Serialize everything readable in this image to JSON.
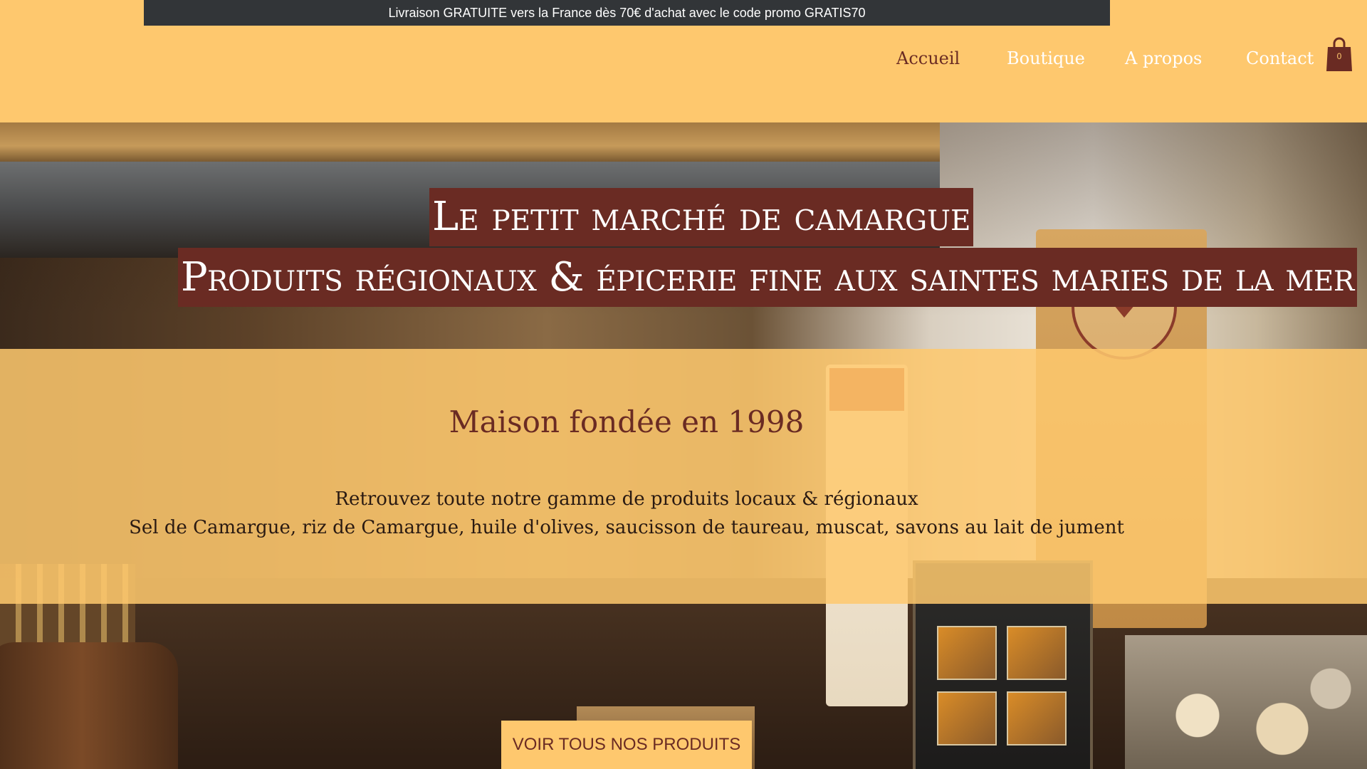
{
  "promo_bar": {
    "text": "Livraison GRATUITE vers la France dès 70€ d'achat avec le code promo GRATIS70"
  },
  "nav": {
    "items": [
      {
        "label": "Accueil",
        "active": true
      },
      {
        "label": "Boutique",
        "active": false
      },
      {
        "label": "A propos",
        "active": false
      },
      {
        "label": "Contact",
        "active": false
      }
    ]
  },
  "cart": {
    "icon": "shopping-bag-icon",
    "count": "0"
  },
  "hero": {
    "title_line1": "Le petit marché de camargue",
    "title_line2": "Produits régionaux & épicerie fine aux saintes maries de la mer"
  },
  "intro": {
    "heading": "Maison fondée en 1998",
    "line1": "Retrouvez toute notre gamme de produits locaux & régionaux",
    "line2": "Sel de Camargue, riz de Camargue, huile d'olives, saucisson de taureau, muscat, savons au lait de jument"
  },
  "cta": {
    "label": "VOIR TOUS NOS PRODUITS"
  },
  "colors": {
    "background": "#fec86e",
    "promo_bar": "#323538",
    "brand_dark": "#6a2b23",
    "nav_inactive": "#ffffff"
  }
}
